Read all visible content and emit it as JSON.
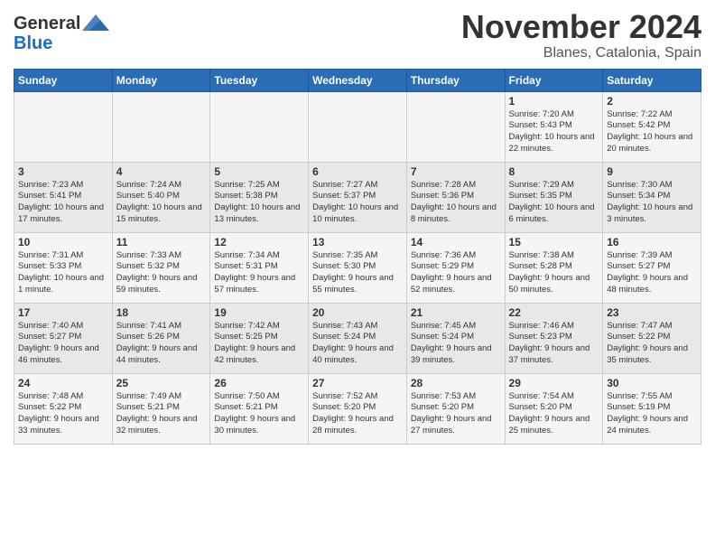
{
  "header": {
    "logo_general": "General",
    "logo_blue": "Blue",
    "month_title": "November 2024",
    "location": "Blanes, Catalonia, Spain"
  },
  "days_of_week": [
    "Sunday",
    "Monday",
    "Tuesday",
    "Wednesday",
    "Thursday",
    "Friday",
    "Saturday"
  ],
  "weeks": [
    {
      "days": [
        {
          "num": "",
          "info": ""
        },
        {
          "num": "",
          "info": ""
        },
        {
          "num": "",
          "info": ""
        },
        {
          "num": "",
          "info": ""
        },
        {
          "num": "",
          "info": ""
        },
        {
          "num": "1",
          "info": "Sunrise: 7:20 AM\nSunset: 5:43 PM\nDaylight: 10 hours and 22 minutes."
        },
        {
          "num": "2",
          "info": "Sunrise: 7:22 AM\nSunset: 5:42 PM\nDaylight: 10 hours and 20 minutes."
        }
      ]
    },
    {
      "days": [
        {
          "num": "3",
          "info": "Sunrise: 7:23 AM\nSunset: 5:41 PM\nDaylight: 10 hours and 17 minutes."
        },
        {
          "num": "4",
          "info": "Sunrise: 7:24 AM\nSunset: 5:40 PM\nDaylight: 10 hours and 15 minutes."
        },
        {
          "num": "5",
          "info": "Sunrise: 7:25 AM\nSunset: 5:38 PM\nDaylight: 10 hours and 13 minutes."
        },
        {
          "num": "6",
          "info": "Sunrise: 7:27 AM\nSunset: 5:37 PM\nDaylight: 10 hours and 10 minutes."
        },
        {
          "num": "7",
          "info": "Sunrise: 7:28 AM\nSunset: 5:36 PM\nDaylight: 10 hours and 8 minutes."
        },
        {
          "num": "8",
          "info": "Sunrise: 7:29 AM\nSunset: 5:35 PM\nDaylight: 10 hours and 6 minutes."
        },
        {
          "num": "9",
          "info": "Sunrise: 7:30 AM\nSunset: 5:34 PM\nDaylight: 10 hours and 3 minutes."
        }
      ]
    },
    {
      "days": [
        {
          "num": "10",
          "info": "Sunrise: 7:31 AM\nSunset: 5:33 PM\nDaylight: 10 hours and 1 minute."
        },
        {
          "num": "11",
          "info": "Sunrise: 7:33 AM\nSunset: 5:32 PM\nDaylight: 9 hours and 59 minutes."
        },
        {
          "num": "12",
          "info": "Sunrise: 7:34 AM\nSunset: 5:31 PM\nDaylight: 9 hours and 57 minutes."
        },
        {
          "num": "13",
          "info": "Sunrise: 7:35 AM\nSunset: 5:30 PM\nDaylight: 9 hours and 55 minutes."
        },
        {
          "num": "14",
          "info": "Sunrise: 7:36 AM\nSunset: 5:29 PM\nDaylight: 9 hours and 52 minutes."
        },
        {
          "num": "15",
          "info": "Sunrise: 7:38 AM\nSunset: 5:28 PM\nDaylight: 9 hours and 50 minutes."
        },
        {
          "num": "16",
          "info": "Sunrise: 7:39 AM\nSunset: 5:27 PM\nDaylight: 9 hours and 48 minutes."
        }
      ]
    },
    {
      "days": [
        {
          "num": "17",
          "info": "Sunrise: 7:40 AM\nSunset: 5:27 PM\nDaylight: 9 hours and 46 minutes."
        },
        {
          "num": "18",
          "info": "Sunrise: 7:41 AM\nSunset: 5:26 PM\nDaylight: 9 hours and 44 minutes."
        },
        {
          "num": "19",
          "info": "Sunrise: 7:42 AM\nSunset: 5:25 PM\nDaylight: 9 hours and 42 minutes."
        },
        {
          "num": "20",
          "info": "Sunrise: 7:43 AM\nSunset: 5:24 PM\nDaylight: 9 hours and 40 minutes."
        },
        {
          "num": "21",
          "info": "Sunrise: 7:45 AM\nSunset: 5:24 PM\nDaylight: 9 hours and 39 minutes."
        },
        {
          "num": "22",
          "info": "Sunrise: 7:46 AM\nSunset: 5:23 PM\nDaylight: 9 hours and 37 minutes."
        },
        {
          "num": "23",
          "info": "Sunrise: 7:47 AM\nSunset: 5:22 PM\nDaylight: 9 hours and 35 minutes."
        }
      ]
    },
    {
      "days": [
        {
          "num": "24",
          "info": "Sunrise: 7:48 AM\nSunset: 5:22 PM\nDaylight: 9 hours and 33 minutes."
        },
        {
          "num": "25",
          "info": "Sunrise: 7:49 AM\nSunset: 5:21 PM\nDaylight: 9 hours and 32 minutes."
        },
        {
          "num": "26",
          "info": "Sunrise: 7:50 AM\nSunset: 5:21 PM\nDaylight: 9 hours and 30 minutes."
        },
        {
          "num": "27",
          "info": "Sunrise: 7:52 AM\nSunset: 5:20 PM\nDaylight: 9 hours and 28 minutes."
        },
        {
          "num": "28",
          "info": "Sunrise: 7:53 AM\nSunset: 5:20 PM\nDaylight: 9 hours and 27 minutes."
        },
        {
          "num": "29",
          "info": "Sunrise: 7:54 AM\nSunset: 5:20 PM\nDaylight: 9 hours and 25 minutes."
        },
        {
          "num": "30",
          "info": "Sunrise: 7:55 AM\nSunset: 5:19 PM\nDaylight: 9 hours and 24 minutes."
        }
      ]
    }
  ]
}
